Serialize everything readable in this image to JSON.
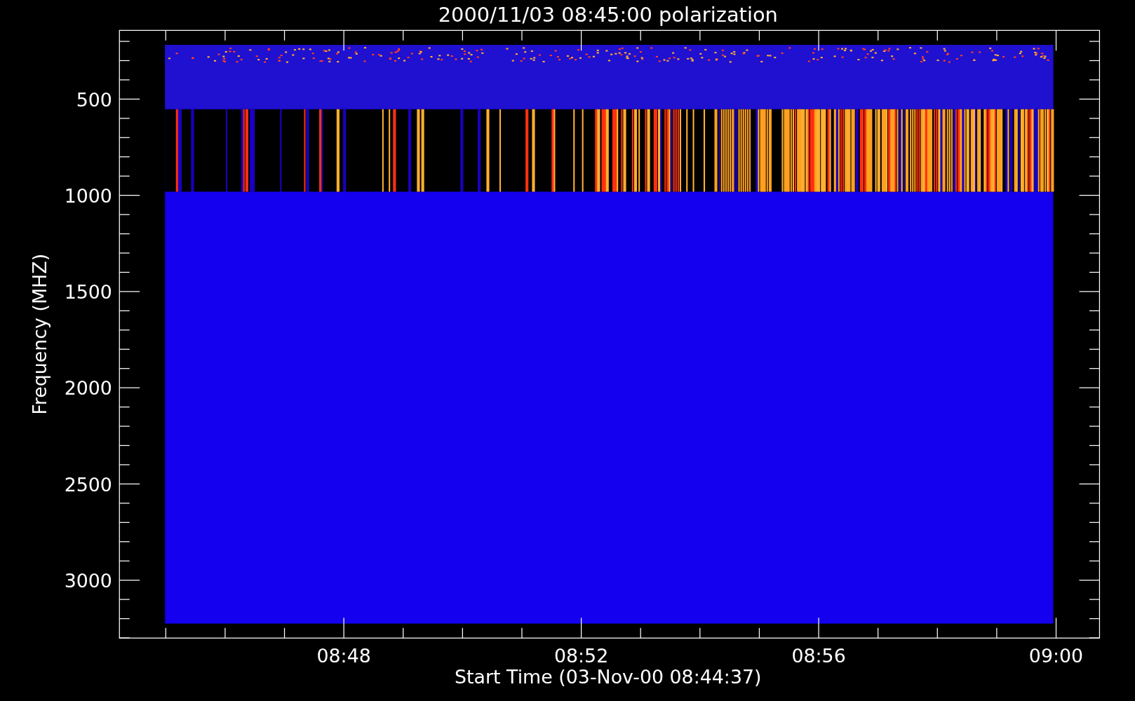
{
  "plot": {
    "title": "2000/11/03 08:45:00 polarization",
    "xlabel": "Start Time (03-Nov-00 08:44:37)",
    "ylabel": "Frequency (MHZ)",
    "xticks": [
      "08:48",
      "08:52",
      "08:56",
      "09:00"
    ],
    "yticks": [
      "500",
      "1000",
      "1500",
      "2000",
      "2500",
      "3000"
    ]
  }
}
